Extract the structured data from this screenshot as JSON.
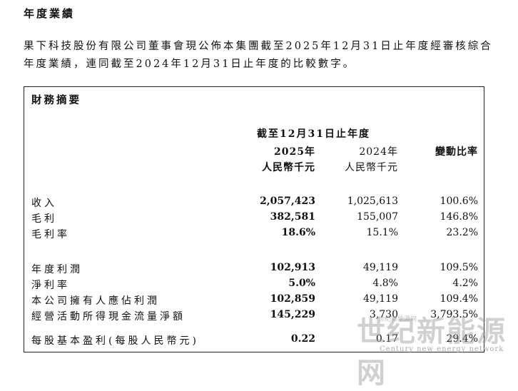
{
  "heading": "年度業績",
  "intro": "果下科技股份有限公司董事會現公佈本集團截至2025年12月31日止年度經審核綜合年度業績，連同截至2024年12月31日止年度的比較數字。",
  "summary": {
    "title": "財務摘要",
    "period_header": "截至12月31日止年度",
    "columns": [
      {
        "year": "2025年",
        "unit": "人民幣千元"
      },
      {
        "year": "2024年",
        "unit": "人民幣千元"
      },
      {
        "label": "變動比率"
      }
    ],
    "rows": [
      {
        "label": "收入",
        "y2025": "2,057,423",
        "y2024": "1,025,613",
        "change": "100.6%"
      },
      {
        "label": "毛利",
        "y2025": "382,581",
        "y2024": "155,007",
        "change": "146.8%"
      },
      {
        "label": "毛利率",
        "y2025": "18.6%",
        "y2024": "15.1%",
        "change": "23.2%"
      },
      {
        "label": "年度利潤",
        "y2025": "102,913",
        "y2024": "49,119",
        "change": "109.5%"
      },
      {
        "label": "淨利率",
        "y2025": "5.0%",
        "y2024": "4.8%",
        "change": "4.2%"
      },
      {
        "label": "本公司擁有人應佔利潤",
        "y2025": "102,859",
        "y2024": "49,119",
        "change": "109.4%"
      },
      {
        "label": "經營活動所得現金流量淨額",
        "y2025": "145,229",
        "y2024": "3,730",
        "change": "3,793.5%"
      },
      {
        "label": "每股基本盈利(每股人民幣元)",
        "y2025": "0.22",
        "y2024": "0.17",
        "change": "29.4%"
      }
    ]
  },
  "watermark": {
    "name": "世纪新能源网",
    "small": "世纪新能源网",
    "tagline": "Century new energy network"
  }
}
